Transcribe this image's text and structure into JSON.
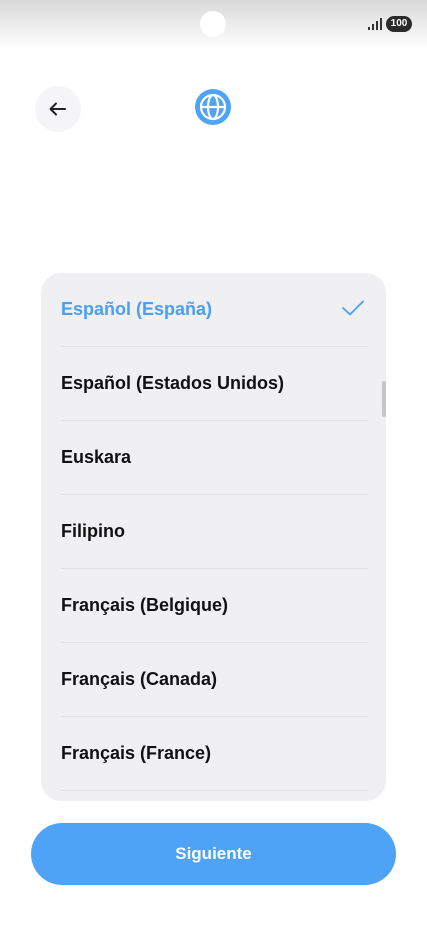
{
  "status_bar": {
    "battery_level": "100",
    "signal_icon": "signal-bars-icon"
  },
  "header": {
    "back_icon": "arrow-left-icon",
    "globe_icon": "globe-icon"
  },
  "languages": {
    "items": [
      {
        "label": "Español (España)",
        "selected": true
      },
      {
        "label": "Español (Estados Unidos)",
        "selected": false
      },
      {
        "label": "Euskara",
        "selected": false
      },
      {
        "label": "Filipino",
        "selected": false
      },
      {
        "label": "Français (Belgique)",
        "selected": false
      },
      {
        "label": "Français (Canada)",
        "selected": false
      },
      {
        "label": "Français (France)",
        "selected": false
      }
    ],
    "check_icon": "checkmark-icon"
  },
  "footer": {
    "next_label": "Siguiente"
  },
  "colors": {
    "accent": "#4ea3f7",
    "selected_text": "#4a9ff5",
    "card_background": "#f0f0f3"
  }
}
